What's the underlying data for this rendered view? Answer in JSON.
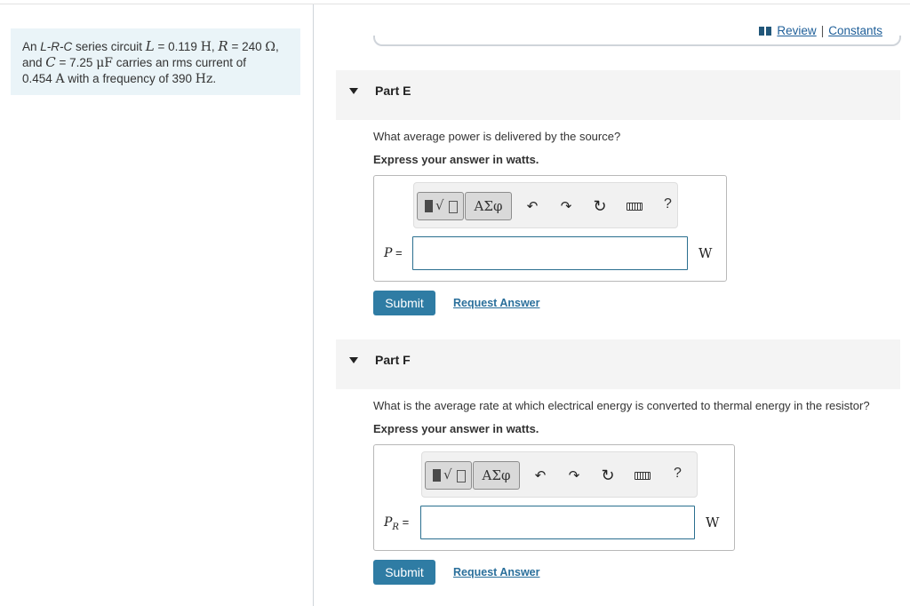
{
  "problem": {
    "t1": "An ",
    "circuit": "L-R-C",
    "t2": " series circuit ",
    "L_sym": "L",
    "eq1": " = 0.119 ",
    "L_unit": "H",
    "comma1": ", ",
    "R_sym": "R",
    "eq2": " = 240 ",
    "R_unit": "Ω",
    "comma2": ",",
    "t3": "and ",
    "C_sym": "C",
    "eq3": " = 7.25 ",
    "C_unit": "μF",
    "t4": " carries an rms current of",
    "I_val": "0.454 ",
    "I_unit": "A",
    "t5": " with a frequency of 390 ",
    "f_unit": "Hz",
    "t6": "."
  },
  "header": {
    "review": "Review",
    "sep": "|",
    "constants": "Constants"
  },
  "toolbar": {
    "greek": "ΑΣφ",
    "radical": "√",
    "help": "?",
    "undo": "↶",
    "redo": "↷",
    "reset": "↻"
  },
  "parts": [
    {
      "title": "Part E",
      "question": "What average power is delivered by the source?",
      "hint": "Express your answer in watts.",
      "var": "P",
      "var_sub": "",
      "eq": " =",
      "unit": "W",
      "submit": "Submit",
      "request": "Request Answer"
    },
    {
      "title": "Part F",
      "question": "What is the average rate at which electrical energy is converted to thermal energy in the resistor?",
      "hint": "Express your answer in watts.",
      "var": "P",
      "var_sub": "R",
      "eq": " =",
      "unit": "W",
      "submit": "Submit",
      "request": "Request Answer"
    }
  ]
}
